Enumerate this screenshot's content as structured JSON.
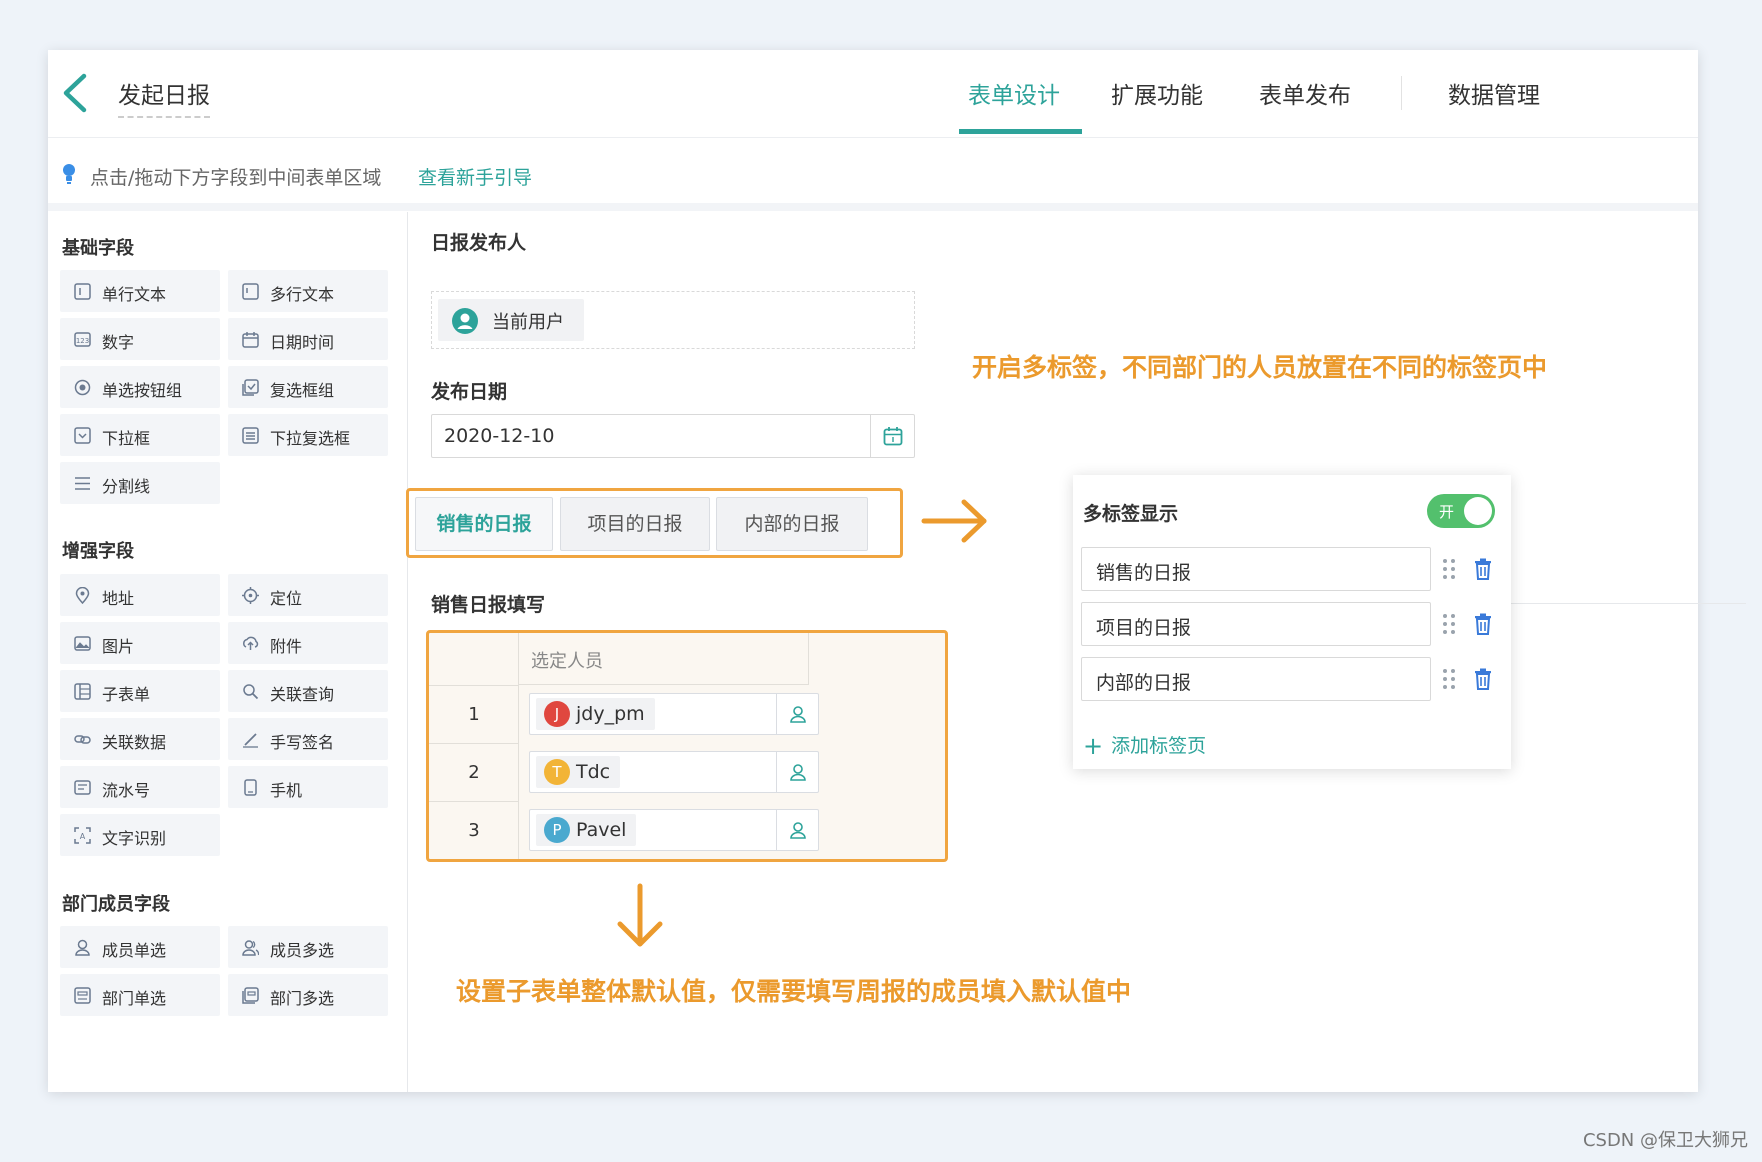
{
  "header": {
    "title": "发起日报",
    "tabs": [
      {
        "label": "表单设计",
        "active": true
      },
      {
        "label": "扩展功能",
        "active": false
      },
      {
        "label": "表单发布",
        "active": false
      },
      {
        "label": "数据管理",
        "active": false
      }
    ]
  },
  "hint": {
    "text": "点击/拖动下方字段到中间表单区域",
    "link": "查看新手引导"
  },
  "sidebar": {
    "basic_title": "基础字段",
    "basic": [
      "单行文本",
      "多行文本",
      "数字",
      "日期时间",
      "单选按钮组",
      "复选框组",
      "下拉框",
      "下拉复选框",
      "分割线"
    ],
    "enhanced_title": "增强字段",
    "enhanced": [
      "地址",
      "定位",
      "图片",
      "附件",
      "子表单",
      "关联查询",
      "关联数据",
      "手写签名",
      "流水号",
      "手机",
      "文字识别"
    ],
    "dept_title": "部门成员字段",
    "dept": [
      "成员单选",
      "成员多选",
      "部门单选",
      "部门多选"
    ]
  },
  "form": {
    "publisher_label": "日报发布人",
    "publisher_value": "当前用户",
    "date_label": "发布日期",
    "date_value": "2020-12-10",
    "tabs": [
      "销售的日报",
      "项目的日报",
      "内部的日报"
    ],
    "subform_label": "销售日报填写",
    "subform_header": "选定人员",
    "subform_rows": [
      {
        "no": "1",
        "initial": "J",
        "name": "jdy_pm",
        "color": "#e0473f"
      },
      {
        "no": "2",
        "initial": "T",
        "name": "Tdc",
        "color": "#f2b437"
      },
      {
        "no": "3",
        "initial": "P",
        "name": "Pavel",
        "color": "#4aa9cf"
      }
    ]
  },
  "panel": {
    "title": "多标签显示",
    "toggle_label": "开",
    "toggle_on": true,
    "tabs": [
      "销售的日报",
      "项目的日报",
      "内部的日报"
    ],
    "add_label": "添加标签页"
  },
  "annotations": {
    "top": "开启多标签，不同部门的人员放置在不同的标签页中",
    "bottom": "设置子表单整体默认值，仅需要填写周报的成员填入默认值中"
  },
  "colors": {
    "accent": "#2da39a",
    "highlight": "#f0a540",
    "toggle": "#53c06d"
  },
  "watermark": "CSDN @保卫大狮兄"
}
